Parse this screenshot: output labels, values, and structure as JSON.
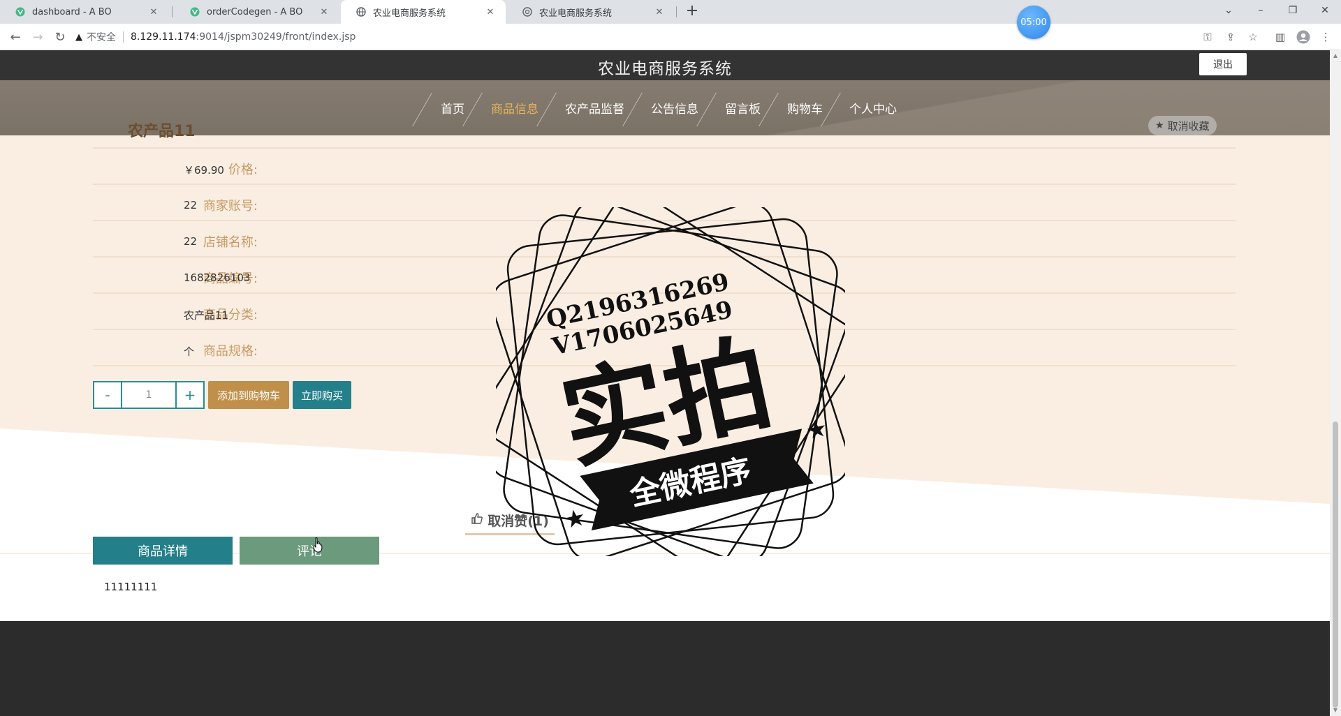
{
  "browser": {
    "tabs": [
      {
        "title": "dashboard - A BO",
        "icon": "vue-icon"
      },
      {
        "title": "orderCodegen - A BO",
        "icon": "vue-icon"
      },
      {
        "title": "农业电商服务系统",
        "icon": "globe-icon",
        "active": true
      },
      {
        "title": "农业电商服务系统",
        "icon": "shield-icon"
      }
    ],
    "timer": "05:00",
    "security_label": "不安全",
    "url_host": "8.129.11.174",
    "url_path": ":9014/jspm30249/front/index.jsp"
  },
  "site": {
    "title": "农业电商服务系统",
    "logout_label": "退出",
    "nav": [
      "首页",
      "商品信息",
      "农产品监督",
      "公告信息",
      "留言板",
      "购物车",
      "个人中心"
    ],
    "nav_active_index": 1
  },
  "product": {
    "name": "农产品11",
    "favorite_label": "取消收藏",
    "attributes": [
      {
        "label": "价格:",
        "value": "￥69.90"
      },
      {
        "label": "商家账号:",
        "value": "22"
      },
      {
        "label": "店铺名称:",
        "value": "22"
      },
      {
        "label": "商品编号:",
        "value": "1682826103"
      },
      {
        "label": "商品分类:",
        "value": "农产品11"
      },
      {
        "label": "商品规格:",
        "value": "个"
      }
    ],
    "quantity": "1",
    "minus_label": "-",
    "plus_label": "+",
    "add_to_cart_label": "添加到购物车",
    "buy_now_label": "立即购买",
    "like_label": "取消赞(1)",
    "tabs": [
      "商品详情",
      "评论"
    ],
    "detail_text": "11111111"
  },
  "watermark": {
    "line1": "Q2196316269",
    "line2": "V1706025649",
    "main": "实拍",
    "ribbon": "全微程序"
  },
  "colors": {
    "header_bg": "#333333",
    "nav_active": "#e6b45a",
    "detail_bg": "#faeee3",
    "teal": "#23808a",
    "gold": "#c08f4a",
    "review_tab": "#6b9a7c",
    "footer_bg": "#2c2c2c"
  }
}
